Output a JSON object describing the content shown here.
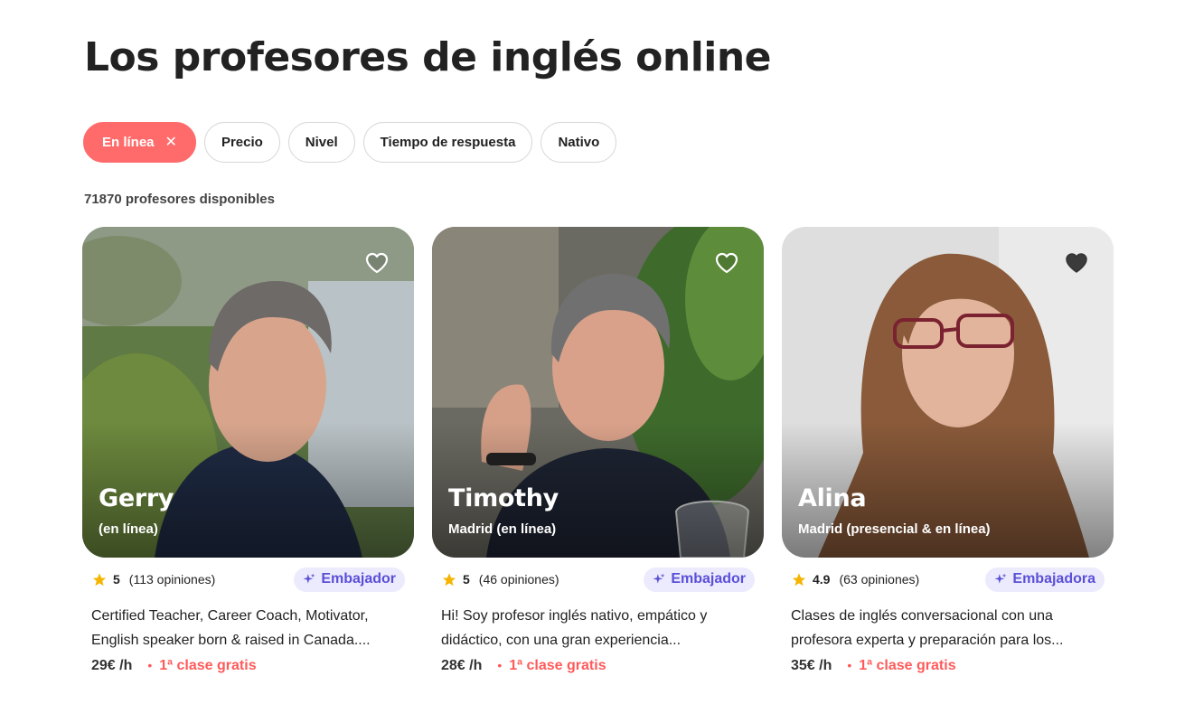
{
  "page": {
    "title": "Los profesores de inglés online"
  },
  "filters": [
    {
      "label": "En línea",
      "active": true
    },
    {
      "label": "Precio"
    },
    {
      "label": "Nivel"
    },
    {
      "label": "Tiempo de respuesta"
    },
    {
      "label": "Nativo"
    }
  ],
  "results_count": "71870 profesores disponibles",
  "icons": {
    "close": "close-icon",
    "heart": "heart-icon",
    "star": "star-icon",
    "badge": "sparkle-icon"
  },
  "colors": {
    "accent": "#ff6b6b",
    "badge_bg": "#eceafd",
    "badge_text": "#5a50d8",
    "star": "#f5b400"
  },
  "teachers": [
    {
      "name": "Gerry",
      "location": "(en línea)",
      "rating": "5",
      "reviews": "(113 opiniones)",
      "badge": "Embajador",
      "description": "Certified Teacher, Career Coach, Motivator, English speaker born & raised in Canada....",
      "price": "29€ /h",
      "offer": "1ª clase gratis"
    },
    {
      "name": "Timothy",
      "location": "Madrid (en línea)",
      "rating": "5",
      "reviews": "(46 opiniones)",
      "badge": "Embajador",
      "description": "Hi! Soy profesor inglés nativo, empático y didáctico, con una gran experiencia...",
      "price": "28€ /h",
      "offer": "1ª clase gratis"
    },
    {
      "name": "Alina",
      "location": "Madrid (presencial & en línea)",
      "rating": "4.9",
      "reviews": "(63 opiniones)",
      "badge": "Embajadora",
      "description": "Clases de inglés conversacional con una profesora experta y preparación para los...",
      "price": "35€ /h",
      "offer": "1ª clase gratis"
    }
  ]
}
